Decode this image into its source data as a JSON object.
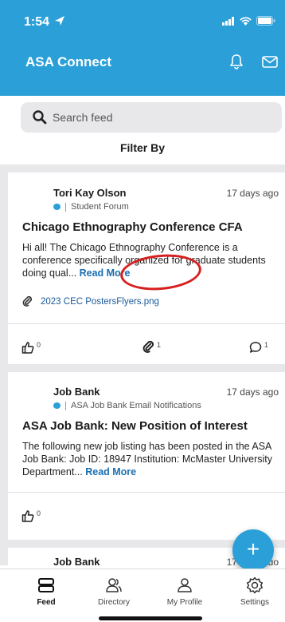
{
  "status_bar": {
    "time": "1:54"
  },
  "header": {
    "title": "ASA Connect",
    "icons": [
      "bell-icon",
      "mail-icon"
    ],
    "background_color": "#2a9fd8"
  },
  "search": {
    "placeholder": "Search feed"
  },
  "filter_label": "Filter By",
  "posts": [
    {
      "author": "Tori Kay Olson",
      "forum": "Student Forum",
      "time": "17 days ago",
      "title": "Chicago Ethnography Conference CFA",
      "body": "Hi all! The Chicago Ethnography Conference is a conference specifically organized for graduate students doing qual...",
      "read_more": "Read More",
      "attachment": "2023 CEC PostersFlyers.png",
      "likes": "0",
      "attachments_count": "1",
      "comments": "1"
    },
    {
      "author": "Job Bank",
      "forum": "ASA Job Bank Email Notifications",
      "time": "17 days ago",
      "title": "ASA Job Bank: New Position of Interest",
      "body": "The following new job listing has been posted in the ASA Job Bank: Job ID: 18947 Institution: McMaster University Department...",
      "read_more": "Read More",
      "likes": "0"
    },
    {
      "author": "Job Bank",
      "time": "17 days ago"
    }
  ],
  "fab_label": "+",
  "bottom_nav": [
    {
      "label": "Feed",
      "icon": "feed-icon",
      "active": true
    },
    {
      "label": "Directory",
      "icon": "directory-icon"
    },
    {
      "label": "My Profile",
      "icon": "profile-icon"
    },
    {
      "label": "Settings",
      "icon": "settings-icon"
    }
  ],
  "accent_color": "#2a9fd8",
  "annotation_color": "#d62020"
}
